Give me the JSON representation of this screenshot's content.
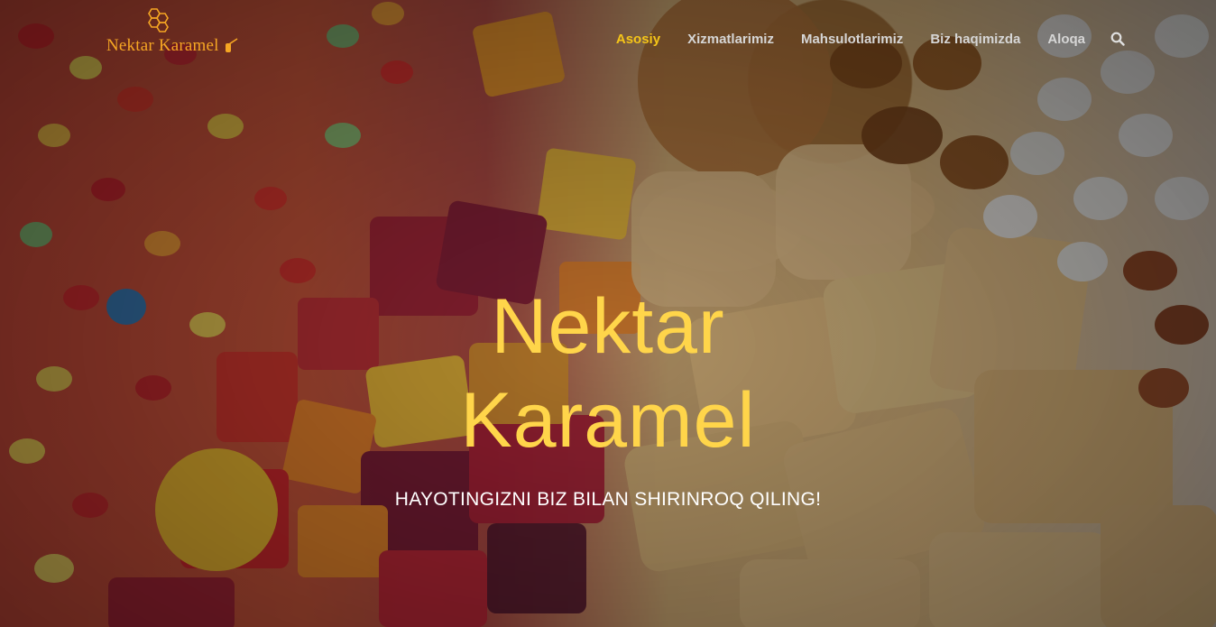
{
  "brand": {
    "name": "Nektar Karamel",
    "accent_color": "#f5a623"
  },
  "nav": {
    "items": [
      {
        "label": "Asosiy",
        "active": true
      },
      {
        "label": "Xizmatlarimiz",
        "active": false
      },
      {
        "label": "Mahsulotlarimiz",
        "active": false
      },
      {
        "label": "Biz haqimizda",
        "active": false
      },
      {
        "label": "Aloqa",
        "active": false
      }
    ],
    "search_icon": "search-icon",
    "active_color": "#f5c518"
  },
  "hero": {
    "title_line1": "Nektar",
    "title_line2": "Karamel",
    "subtitle": "HAYOTINGIZNI BIZ BILAN SHIRINROQ QILING!",
    "title_color": "#ffd54a",
    "background_image": "candies-and-cookies"
  }
}
